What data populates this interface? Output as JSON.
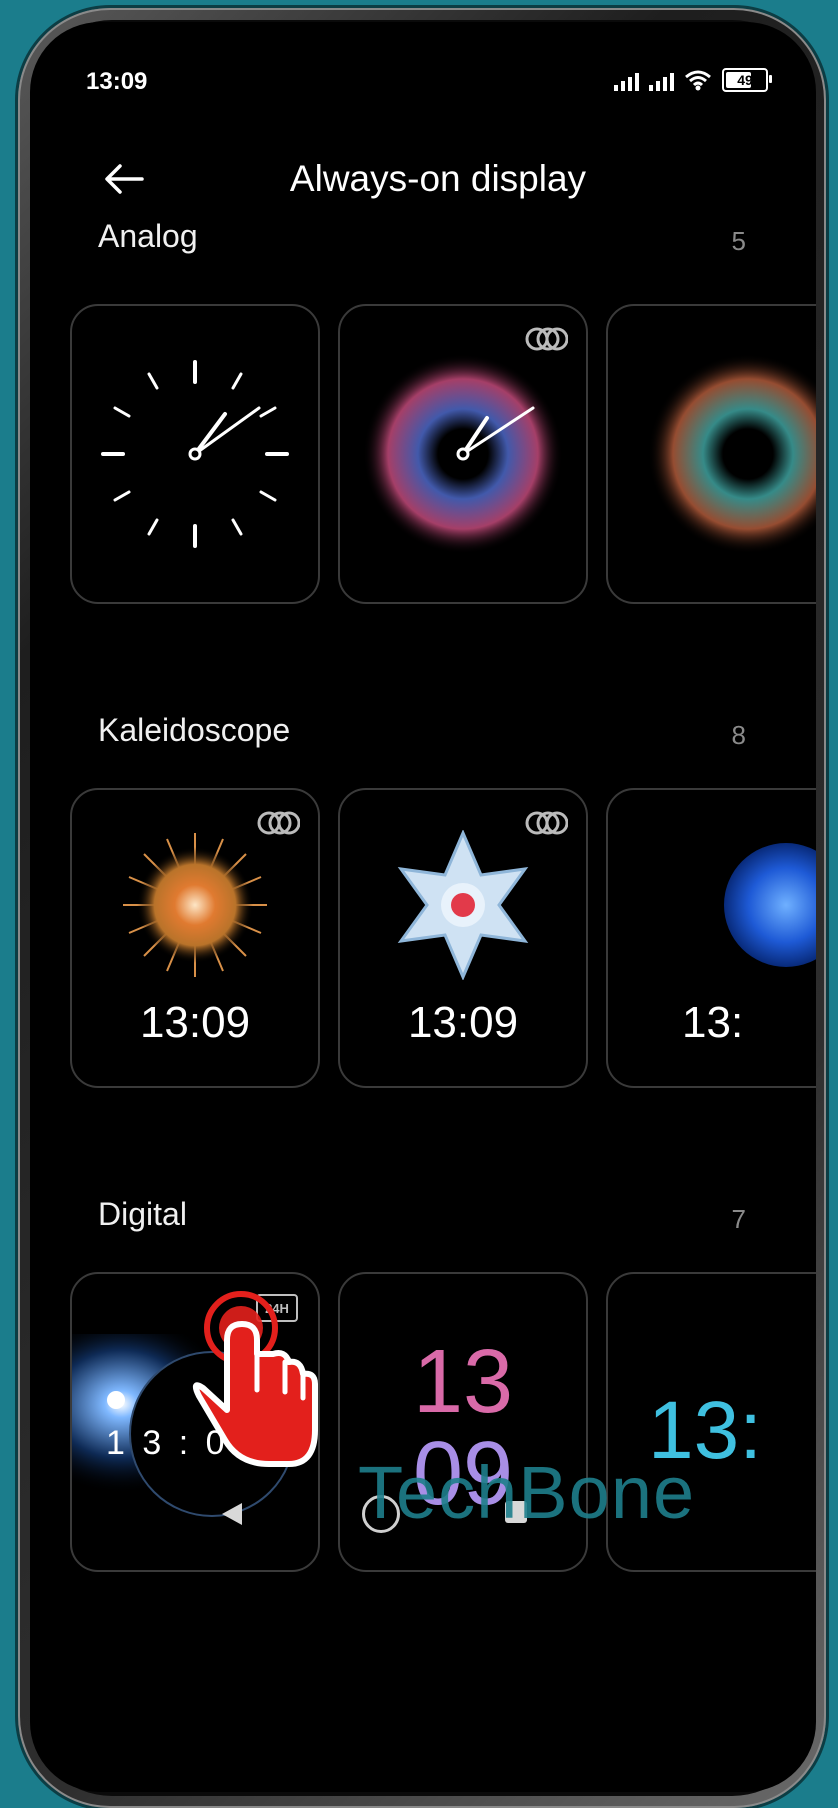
{
  "status_bar": {
    "time": "13:09",
    "battery": "49",
    "signal_icons": [
      "signal-icon",
      "signal-icon",
      "wifi-icon",
      "battery-icon"
    ]
  },
  "header": {
    "title": "Always-on display",
    "back_icon": "arrow-left-icon"
  },
  "sections": [
    {
      "title": "Analog",
      "count": "5"
    },
    {
      "title": "Kaleidoscope",
      "count": "8",
      "card_times": [
        "13:09",
        "13:09",
        "13:"
      ]
    },
    {
      "title": "Digital",
      "count": "7",
      "card1_time": "1 3 : 0 9",
      "card1_badge": "24H",
      "card2_hour": "13",
      "card2_minute": "09",
      "card3_time": "13:"
    }
  ],
  "navbar": {
    "icons": [
      "back-triangle-icon",
      "home-circle-icon",
      "recents-square-icon"
    ]
  },
  "watermark": "TechBone",
  "colors": {
    "background": "#1b7d8c",
    "screen": "#000000",
    "accent_tap": "#e3201c",
    "card_border": "#3a3a3a"
  }
}
